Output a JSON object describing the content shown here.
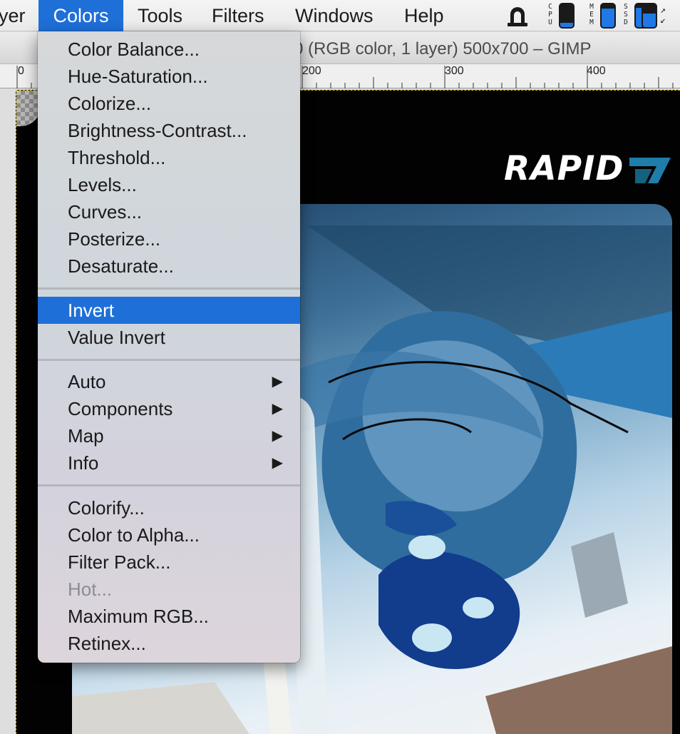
{
  "menubar": {
    "items": [
      "yer",
      "Colors",
      "Tools",
      "Filters",
      "Windows",
      "Help"
    ],
    "active": "Colors",
    "status": [
      {
        "label": "C\nP\nU",
        "level": 0.2
      },
      {
        "label": "M\nE\nM",
        "level": 0.8
      },
      {
        "label": "S\nS\nD",
        "level": 0.85
      },
      {
        "label": "↗\n↙",
        "level": 0.6
      }
    ],
    "icons": [
      "hat-icon"
    ]
  },
  "window": {
    "title": "0 (RGB color, 1 layer) 500x700 – GIMP"
  },
  "ruler": {
    "labels": [
      "0",
      "200",
      "300",
      "400"
    ]
  },
  "canvas": {
    "logo_text": "RAPID"
  },
  "menu": {
    "group1": [
      "Color Balance...",
      "Hue-Saturation...",
      "Colorize...",
      "Brightness-Contrast...",
      "Threshold...",
      "Levels...",
      "Curves...",
      "Posterize...",
      "Desaturate..."
    ],
    "group2": [
      "Invert",
      "Value Invert"
    ],
    "group3": [
      "Auto",
      "Components",
      "Map",
      "Info"
    ],
    "group4": [
      "Colorify...",
      "Color to Alpha...",
      "Filter Pack...",
      "Hot...",
      "Maximum RGB...",
      "Retinex..."
    ],
    "selected": "Invert",
    "disabled": "Hot..."
  },
  "colors": {
    "accent": "#1f6fd8",
    "menubar_bg": "#ececec",
    "menu_bg": "#d3d6da",
    "canvas_bg": "#020202"
  }
}
